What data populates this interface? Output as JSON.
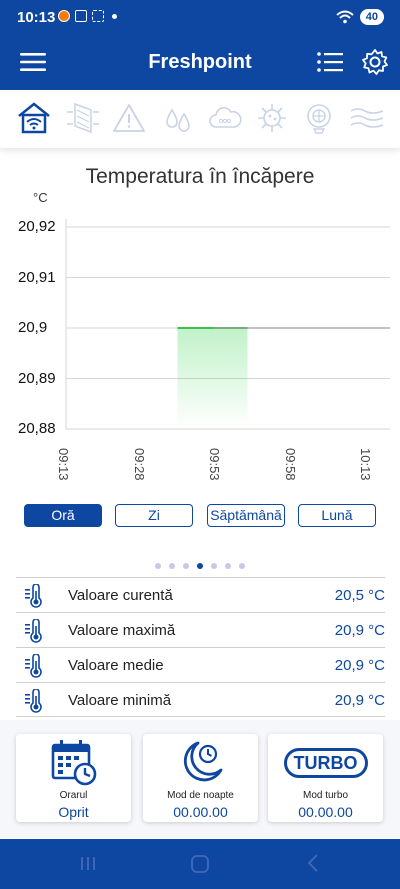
{
  "status_bar": {
    "time": "10:13",
    "battery": "40"
  },
  "app": {
    "title": "Freshpoint"
  },
  "icon_tabs": [
    "home-wifi-icon",
    "heat-exchanger-icon",
    "warning-icon",
    "humidity-icon",
    "co2-cloud-icon",
    "virus-icon",
    "fan-filter-icon",
    "airflow-waves-icon"
  ],
  "chart_data": {
    "type": "line",
    "title": "Temperatura în încăpere",
    "ylabel": "°C",
    "xlabel": "",
    "x_ticks": [
      "09:13",
      "09:28",
      "09:53",
      "09:58",
      "10:13"
    ],
    "y_ticks": [
      "20,92",
      "20,91",
      "20,9",
      "20,89",
      "20,88"
    ],
    "ylim": [
      20.88,
      20.92
    ],
    "grid": true,
    "series": [
      {
        "color": "#3cc24a",
        "points": [
          {
            "x": "09:28",
            "y": 20.9
          },
          {
            "x": "09:53",
            "y": 20.9
          }
        ]
      },
      {
        "color": "#9e9e9e",
        "points": [
          {
            "x": "09:53",
            "y": 20.9
          },
          {
            "x": "10:13",
            "y": 20.9
          }
        ]
      }
    ]
  },
  "range_buttons": [
    {
      "label": "Oră",
      "active": true
    },
    {
      "label": "Zi",
      "active": false
    },
    {
      "label": "Săptămână",
      "active": false
    },
    {
      "label": "Lună",
      "active": false
    }
  ],
  "pager": {
    "count": 7,
    "active_index": 3
  },
  "stats": [
    {
      "label": "Valoare curentă",
      "value": "20,5 °C"
    },
    {
      "label": "Valoare maximă",
      "value": "20,9 °C"
    },
    {
      "label": "Valoare medie",
      "value": "20,9 °C"
    },
    {
      "label": "Valoare minimă",
      "value": "20,9 °C"
    }
  ],
  "cards": [
    {
      "name": "schedule",
      "icon": "calendar-clock-icon",
      "label": "Orarul",
      "value": "Oprit"
    },
    {
      "name": "night-mode",
      "icon": "moon-clock-icon",
      "label": "Mod de noapte",
      "value": "00.00.00"
    },
    {
      "name": "turbo-mode",
      "icon": "turbo-icon",
      "label": "Mod turbo",
      "value": "00.00.00",
      "icon_text": "TURBO"
    }
  ],
  "colors": {
    "primary": "#0d47a1",
    "accent_green": "#3cc24a"
  }
}
